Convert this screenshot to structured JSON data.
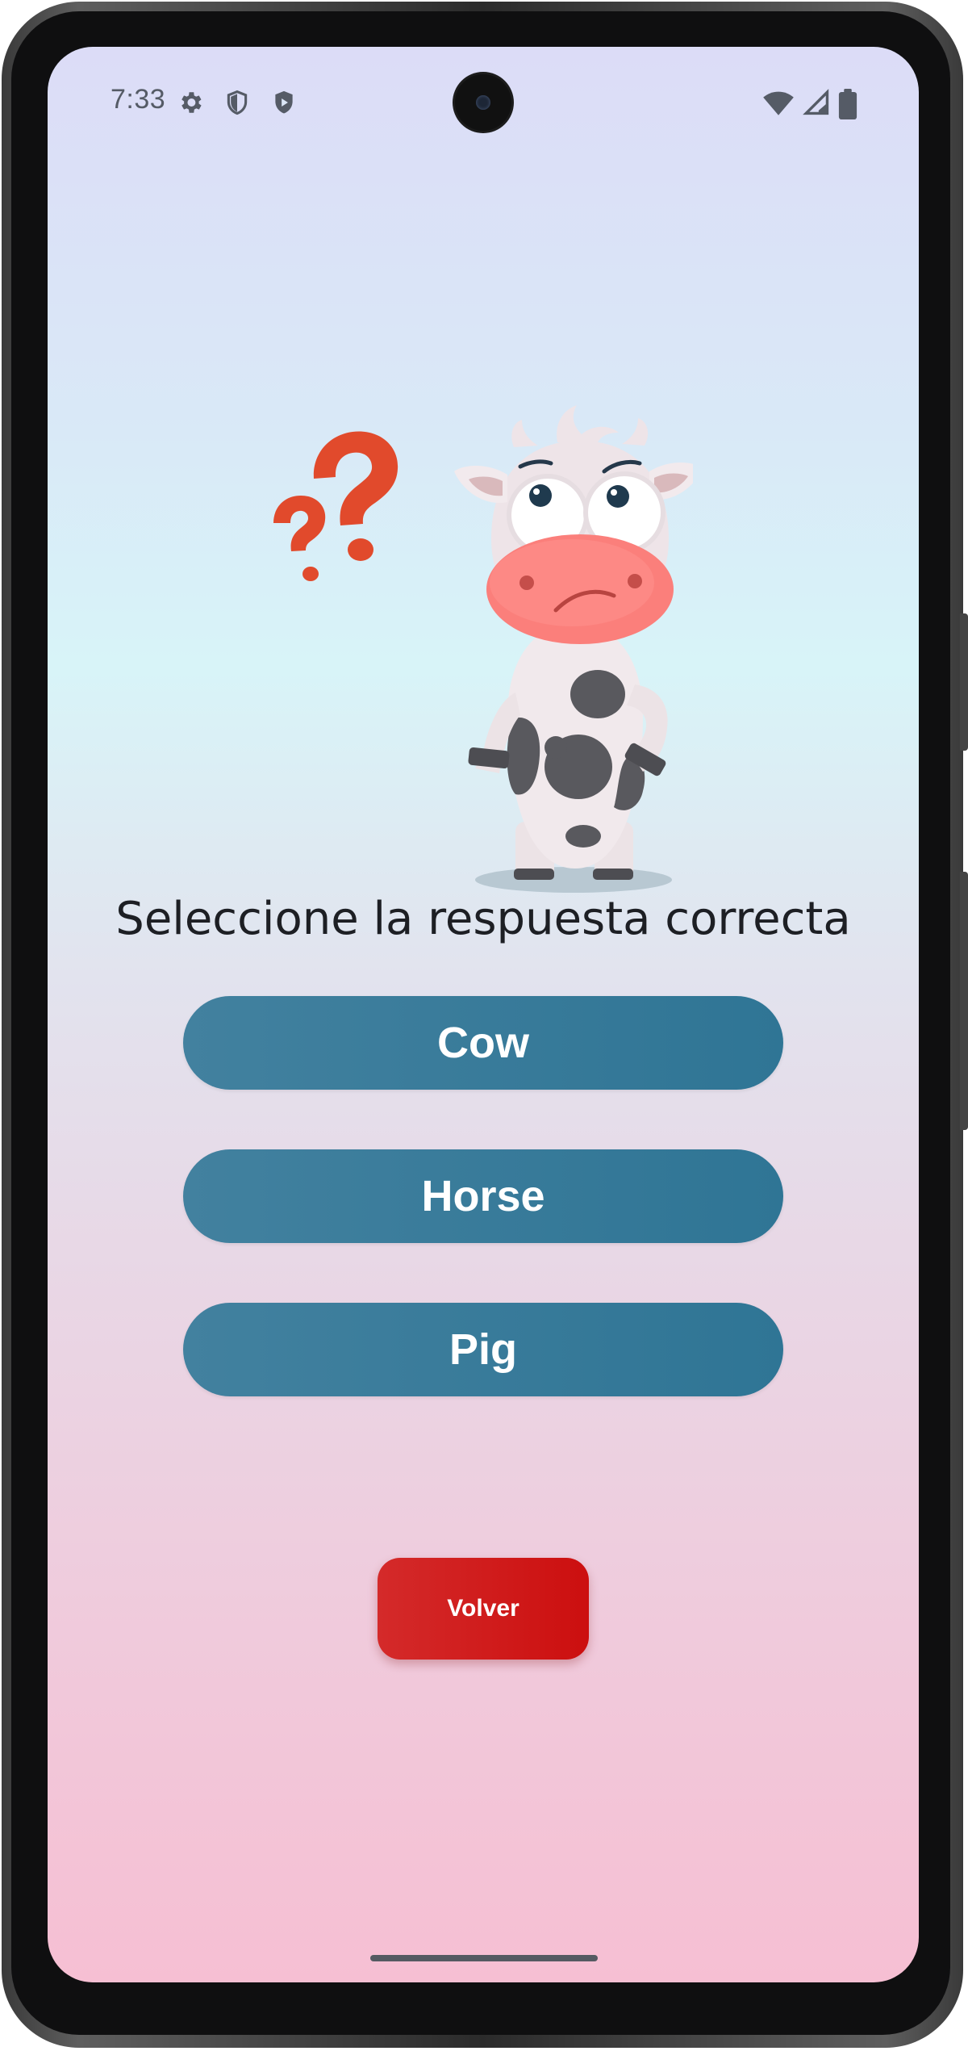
{
  "status_bar": {
    "time": "7:33",
    "left_icons": [
      "gear-icon",
      "shield-outline-icon",
      "shield-play-icon"
    ],
    "right_icons": [
      "wifi-icon",
      "cellular-signal-icon",
      "battery-icon"
    ]
  },
  "quiz": {
    "illustration": "confused-cow-with-question-mark",
    "prompt": "Seleccione la respuesta correcta",
    "options": [
      {
        "label": "Cow"
      },
      {
        "label": "Horse"
      },
      {
        "label": "Pig"
      }
    ],
    "back_label": "Volver"
  },
  "colors": {
    "option_button": "#3a7c9c",
    "back_button": "#cc1a1a",
    "question_mark": "#e14a2c",
    "cow_muzzle": "#fb7f7b"
  }
}
